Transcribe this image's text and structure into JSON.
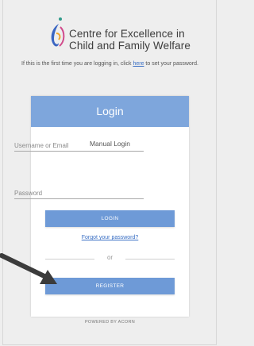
{
  "logo": {
    "line1": "Centre for Excellence in",
    "line2": "Child and Family Welfare",
    "icon": "organization-logo-icon"
  },
  "intro": {
    "before": "If this is the first time you are logging in, click ",
    "link": "here",
    "after": " to set your password."
  },
  "card": {
    "header": "Login",
    "manual_title": "Manual Login",
    "username_placeholder": "Username or Email",
    "password_placeholder": "Password",
    "login_label": "LOGIN",
    "forgot_label": "Forgot your password?",
    "or_label": "or",
    "register_label": "REGISTER"
  },
  "footer": {
    "powered": "POWERED BY ACORN"
  },
  "annotation": {
    "icon": "arrow-pointer-icon"
  },
  "colors": {
    "accent": "#7ea6dc",
    "button": "#6e9ad7",
    "link": "#3a6fc4",
    "background": "#eeeeee"
  }
}
